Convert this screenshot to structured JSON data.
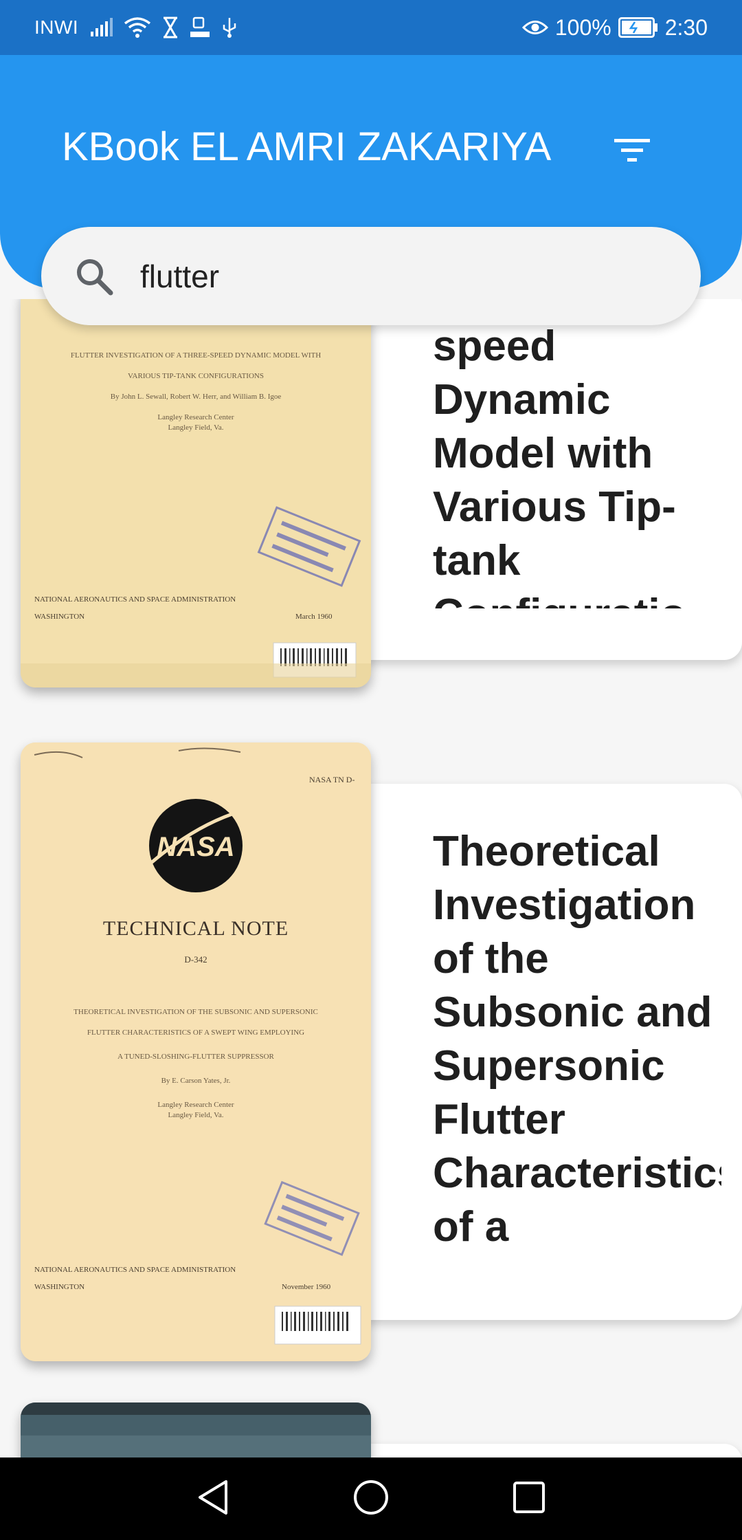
{
  "status_bar": {
    "carrier": "INWI",
    "battery_percent": "100%",
    "time": "2:30",
    "icons": [
      "signal-icon",
      "wifi-icon",
      "hourglass-icon",
      "data-icon",
      "usb-icon",
      "eye-icon",
      "battery-icon"
    ]
  },
  "app_bar": {
    "title": "KBook EL AMRI ZAKARIYA",
    "filter_icon": "filter-icon",
    "color": "#2595ef"
  },
  "search": {
    "value": "flutter",
    "icon": "search-icon"
  },
  "books": [
    {
      "title": "speed Dynamic Model with Various Tip-tank Configuratio",
      "cover": {
        "line1": "FLUTTER INVESTIGATION OF A THREE-SPEED DYNAMIC MODEL WITH",
        "line2": "VARIOUS TIP-TANK CONFIGURATIONS",
        "authors": "By John L. Sewall, Robert W. Herr, and William B. Igoe",
        "center": "Langley Research Center",
        "place": "Langley Field, Va.",
        "agency": "NATIONAL AERONAUTICS AND SPACE ADMINISTRATION",
        "city": "WASHINGTON",
        "date": "March 1960"
      }
    },
    {
      "title": "Theoretical Investigation of the Subsonic and Supersonic Flutter Characteristics of a",
      "cover": {
        "header": "NASA TN D-",
        "logo": "NASA",
        "kind": "TECHNICAL NOTE",
        "number": "D-342",
        "line1": "THEORETICAL INVESTIGATION OF THE SUBSONIC AND SUPERSONIC",
        "line2": "FLUTTER CHARACTERISTICS OF A SWEPT WING EMPLOYING",
        "line3": "A TUNED-SLOSHING-FLUTTER SUPPRESSOR",
        "authors": "By E. Carson Yates, Jr.",
        "center": "Langley Research Center",
        "place": "Langley Field, Va.",
        "agency": "NATIONAL AERONAUTICS AND SPACE ADMINISTRATION",
        "city": "WASHINGTON",
        "date": "November 1960"
      }
    }
  ],
  "nav_bar": {
    "icons": [
      "back-icon",
      "home-icon",
      "recents-icon"
    ]
  }
}
